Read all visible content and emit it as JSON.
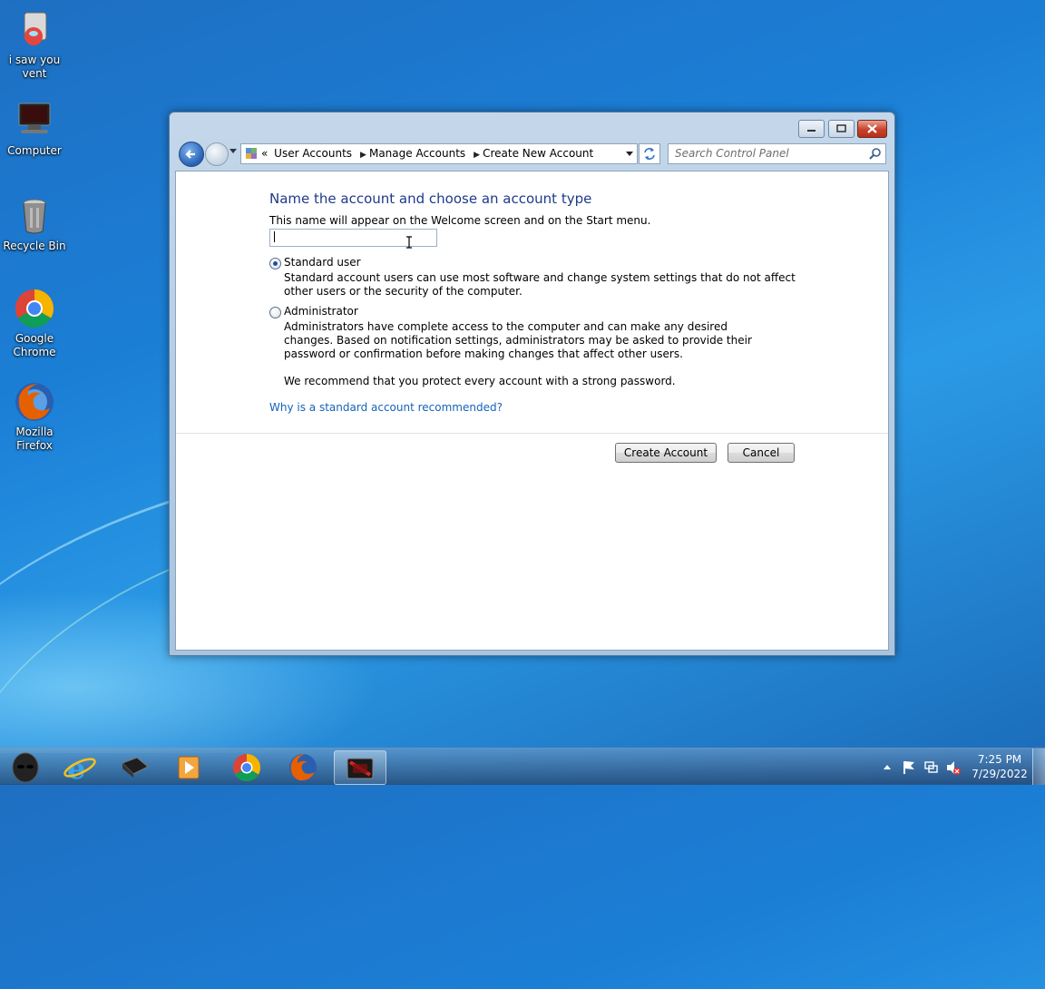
{
  "desktop": {
    "icons": [
      {
        "label": "i saw you vent"
      },
      {
        "label": "Computer"
      },
      {
        "label": "Recycle Bin"
      },
      {
        "label": "Google Chrome"
      },
      {
        "label": "Mozilla Firefox"
      }
    ]
  },
  "window": {
    "breadcrumb": {
      "prefix": "«",
      "items": [
        "User Accounts",
        "Manage Accounts",
        "Create New Account"
      ]
    },
    "search": {
      "placeholder": "Search Control Panel"
    },
    "heading": "Name the account and choose an account type",
    "subtext": "This name will appear on the Welcome screen and on the Start menu.",
    "name_input": {
      "value": ""
    },
    "standard_user": {
      "label": "Standard user",
      "description": "Standard account users can use most software and change system settings that do not affect other users or the security of the computer.",
      "selected": true
    },
    "administrator": {
      "label": "Administrator",
      "description": "Administrators have complete access to the computer and can make any desired changes. Based on notification settings, administrators may be asked to provide their password or confirmation before making changes that affect other users.",
      "recommendation": "We recommend that you protect every account with a strong password.",
      "selected": false
    },
    "help_link": "Why is a standard account recommended?",
    "buttons": {
      "create": "Create Account",
      "cancel": "Cancel"
    }
  },
  "taskbar": {
    "clock": {
      "time": "7:25 PM",
      "date": "7/29/2022"
    }
  }
}
